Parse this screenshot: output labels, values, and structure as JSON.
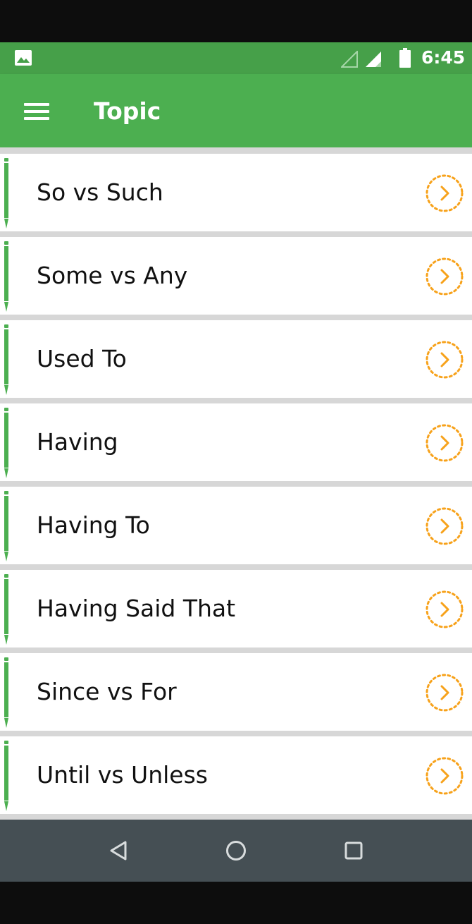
{
  "status_bar": {
    "time": "6:45",
    "icons": [
      "gallery-icon",
      "signal-empty-icon",
      "signal-icon",
      "battery-icon"
    ]
  },
  "app_bar": {
    "title": "Topic",
    "menu_icon": "hamburger-menu-icon"
  },
  "topics": [
    {
      "label": "So vs Such"
    },
    {
      "label": "Some vs Any"
    },
    {
      "label": "Used To"
    },
    {
      "label": "Having"
    },
    {
      "label": "Having To"
    },
    {
      "label": "Having Said That"
    },
    {
      "label": "Since vs For"
    },
    {
      "label": "Until vs Unless"
    }
  ],
  "row_icons": {
    "leading": "pencil-icon",
    "trailing": "chevron-right-circle-icon"
  },
  "nav_bar": {
    "buttons": [
      "back-icon",
      "home-icon",
      "recents-icon"
    ]
  },
  "colors": {
    "status_bar": "#46a049",
    "app_bar": "#4caf50",
    "accent": "#f7a21b",
    "pencil": "#4caf50",
    "nav_bar": "#454f54"
  }
}
